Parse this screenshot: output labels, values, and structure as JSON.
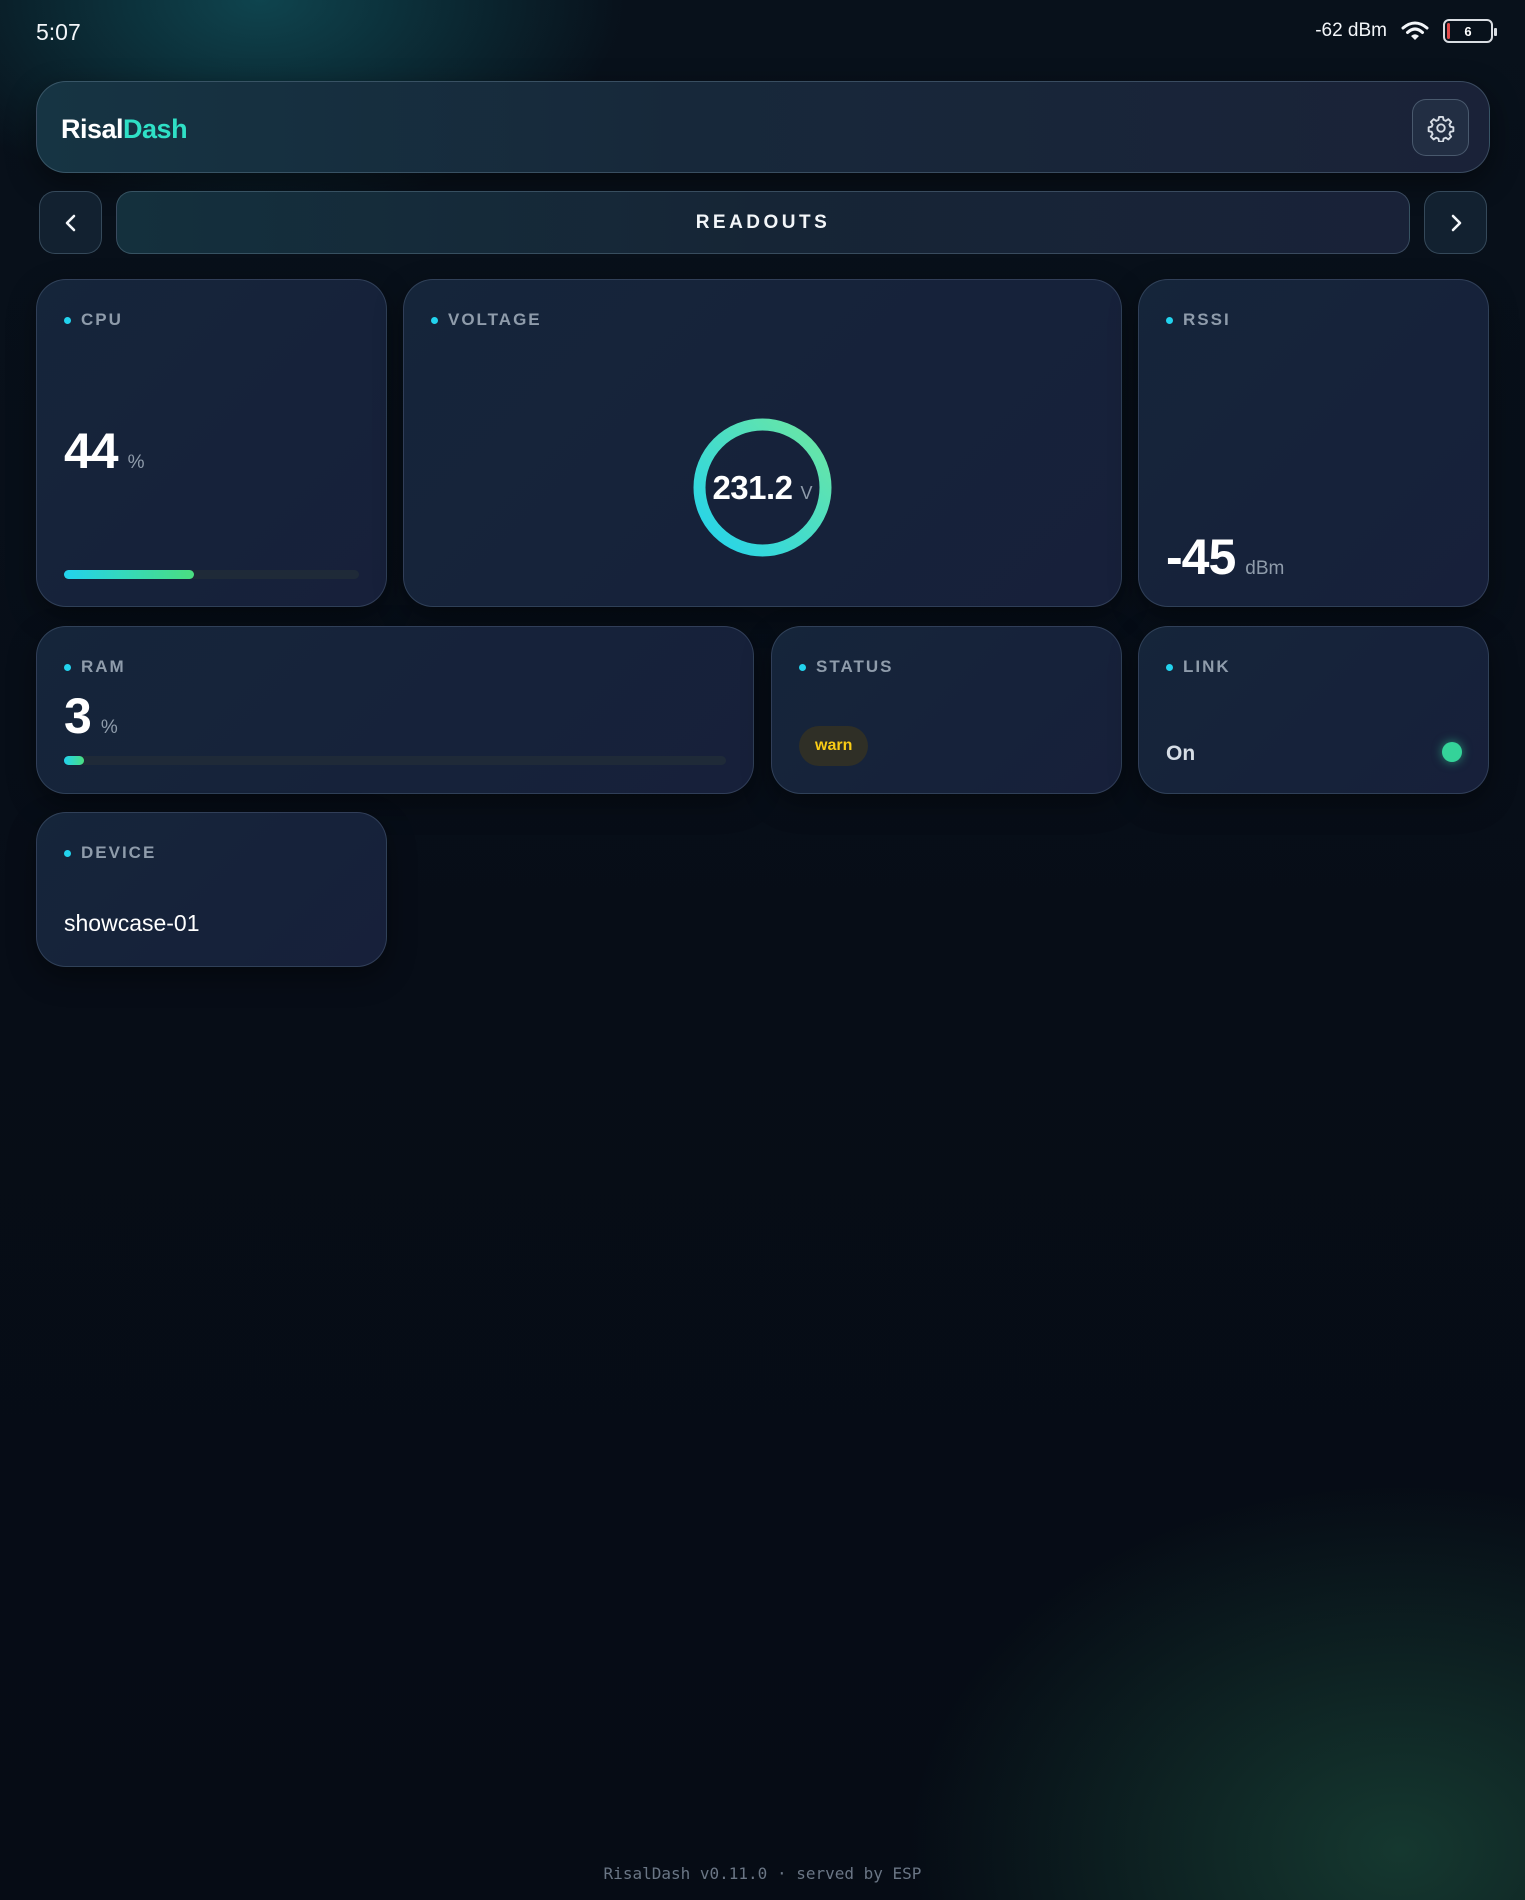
{
  "status_bar": {
    "time": "5:07",
    "signal": "-62 dBm",
    "battery": "6"
  },
  "header": {
    "brand_part1": "Risal",
    "brand_part2": "Dash",
    "settings_icon": "gear-icon"
  },
  "pager": {
    "title": "READOUTS",
    "prev_icon": "chevron-left-icon",
    "next_icon": "chevron-right-icon"
  },
  "cards": {
    "cpu": {
      "label": "CPU",
      "value": "44",
      "unit": "%",
      "progress": 0.44
    },
    "voltage": {
      "label": "VOLTAGE",
      "value": "231.2",
      "unit": "V"
    },
    "rssi": {
      "label": "RSSI",
      "value": "-45",
      "unit": "dBm"
    },
    "ram": {
      "label": "RAM",
      "value": "3",
      "unit": "%",
      "progress": 0.03
    },
    "status": {
      "label": "STATUS",
      "badge": "warn"
    },
    "link": {
      "label": "LINK",
      "value": "On",
      "indicator_on": true
    },
    "device": {
      "label": "DEVICE",
      "value": "showcase-01"
    }
  },
  "footer": {
    "text": "RisalDash v0.11.0 · served by ESP"
  },
  "colors": {
    "accent": "#22d3ee",
    "accent2": "#4ade80",
    "warn": "#facc15",
    "bg": "#070d17"
  }
}
